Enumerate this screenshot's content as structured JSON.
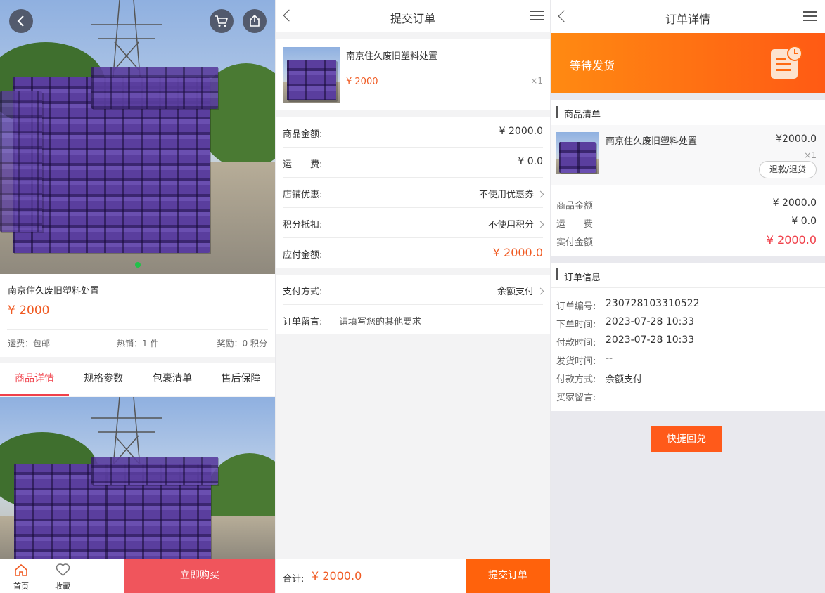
{
  "product": {
    "name": "南京住久废旧塑料处置",
    "price": "¥ 2000",
    "shipping": "运费：包邮",
    "hot_sales": "热销：1 件",
    "reward": "奖励：0 积分",
    "tabs": [
      "商品详情",
      "规格参数",
      "包裹清单",
      "售后保障"
    ],
    "bottom_bar": {
      "home": "首页",
      "favorite": "收藏",
      "buy_now": "立即购买"
    }
  },
  "submit_order": {
    "title": "提交订单",
    "item": {
      "name": "南京住久废旧塑料处置",
      "price": "¥ 2000",
      "qty": "×1"
    },
    "rows": [
      {
        "label": "商品金额:",
        "value": "¥ 2000.0"
      },
      {
        "label": "运　　费:",
        "value": "¥ 0.0"
      },
      {
        "label": "店铺优惠:",
        "value": "不使用优惠券"
      },
      {
        "label": "积分抵扣:",
        "value": "不使用积分"
      },
      {
        "label": "应付金额:",
        "value": "¥ 2000.0"
      }
    ],
    "payment_label": "支付方式:",
    "payment_value": "余额支付",
    "note_label": "订单留言:",
    "note_placeholder": "请填写您的其他要求",
    "total_label": "合计:",
    "total_value": "¥ 2000.0",
    "submit_button": "提交订单"
  },
  "order_detail": {
    "title": "订单详情",
    "status": "等待发货",
    "goods_section": "商品清单",
    "item": {
      "name": "南京住久废旧塑料处置",
      "price": "¥2000.0",
      "qty": "×1",
      "refund_button": "退款/退货"
    },
    "amounts": [
      {
        "label": "商品金额",
        "value": "¥ 2000.0"
      },
      {
        "label": "运　　费",
        "value": "¥ 0.0"
      },
      {
        "label": "实付金额",
        "value": "¥ 2000.0"
      }
    ],
    "info_section": "订单信息",
    "info": [
      {
        "label": "订单编号:",
        "value": "230728103310522"
      },
      {
        "label": "下单时间:",
        "value": "2023-07-28 10:33"
      },
      {
        "label": "付款时间:",
        "value": "2023-07-28 10:33"
      },
      {
        "label": "发货时间:",
        "value": "--"
      },
      {
        "label": "付款方式:",
        "value": "余额支付"
      },
      {
        "label": "买家留言:",
        "value": ""
      }
    ],
    "redeem_button": "快捷回兑"
  },
  "colors": {
    "accent": "#f05a22",
    "buy_red": "#f0555c",
    "status_orange": "#ff6a12",
    "price_red": "#f0404a"
  },
  "icons": [
    "back-icon",
    "cart-icon",
    "share-icon",
    "menu-icon",
    "home-icon",
    "heart-icon",
    "clipboard-clock-icon",
    "chevron-right-icon"
  ]
}
